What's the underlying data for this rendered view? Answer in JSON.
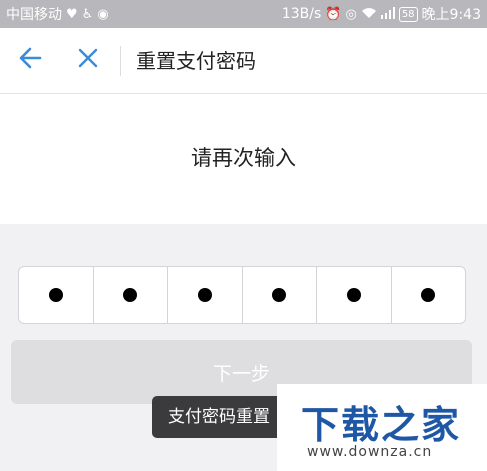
{
  "status_bar": {
    "carrier": "中国移动",
    "left_icons": [
      "heart-icon",
      "accessibility-icon",
      "alarm-icon"
    ],
    "speed": "13B/s",
    "right_icons": [
      "alarm-clock-icon",
      "eye-icon",
      "wifi-icon",
      "signal-icon"
    ],
    "battery": "58",
    "time": "晚上9:43"
  },
  "header": {
    "title": "重置支付密码",
    "back_icon": "arrow-left-icon",
    "close_icon": "close-icon",
    "accent_color": "#3a8bd8"
  },
  "prompt": {
    "text": "请再次输入"
  },
  "pin": {
    "length": 6,
    "filled": 6
  },
  "next_button": {
    "label": "下一步"
  },
  "toast": {
    "text": "支付密码重置"
  },
  "watermark": {
    "logo": "下载之家",
    "url": "www.downza.cn"
  }
}
